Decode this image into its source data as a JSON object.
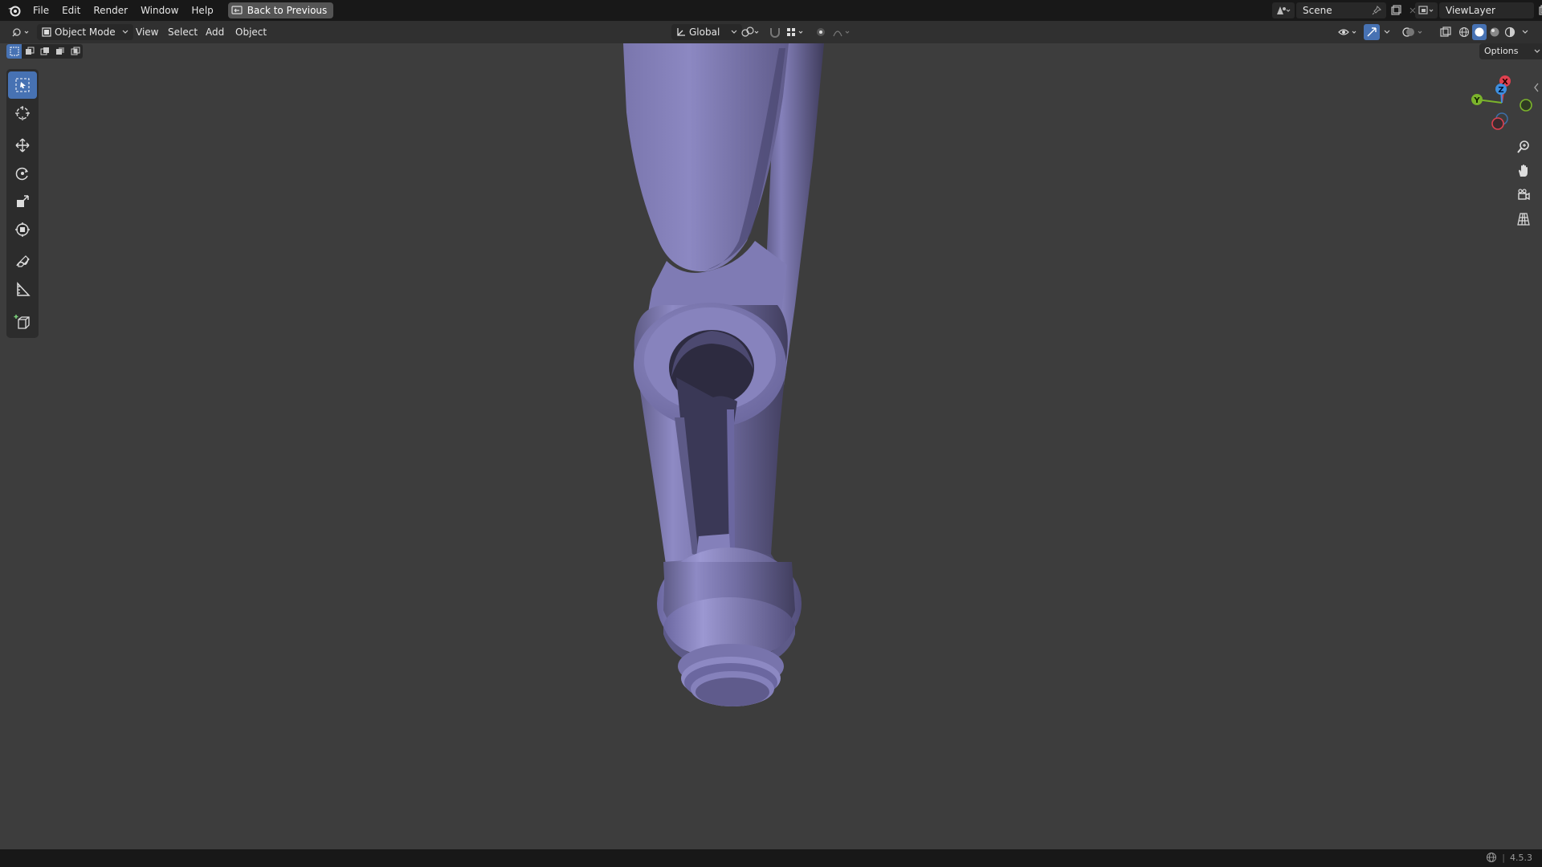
{
  "app": {
    "version": "4.5.3"
  },
  "topbar": {
    "menus": [
      "File",
      "Edit",
      "Render",
      "Window",
      "Help"
    ],
    "back_label": "Back to Previous",
    "scene_label": "Scene",
    "viewlayer_label": "ViewLayer"
  },
  "header": {
    "mode_label": "Object Mode",
    "menus": [
      "View",
      "Select",
      "Add",
      "Object"
    ],
    "orientation_label": "Global",
    "options_label": "Options"
  },
  "gizmo": {
    "x_label": "X",
    "y_label": "Y",
    "z_label": "Z"
  },
  "colors": {
    "accent": "#4772b3",
    "model": "#8a86bc",
    "axis_x": "#e0404f",
    "axis_y": "#7bb42b",
    "axis_z": "#3d8fe0"
  }
}
